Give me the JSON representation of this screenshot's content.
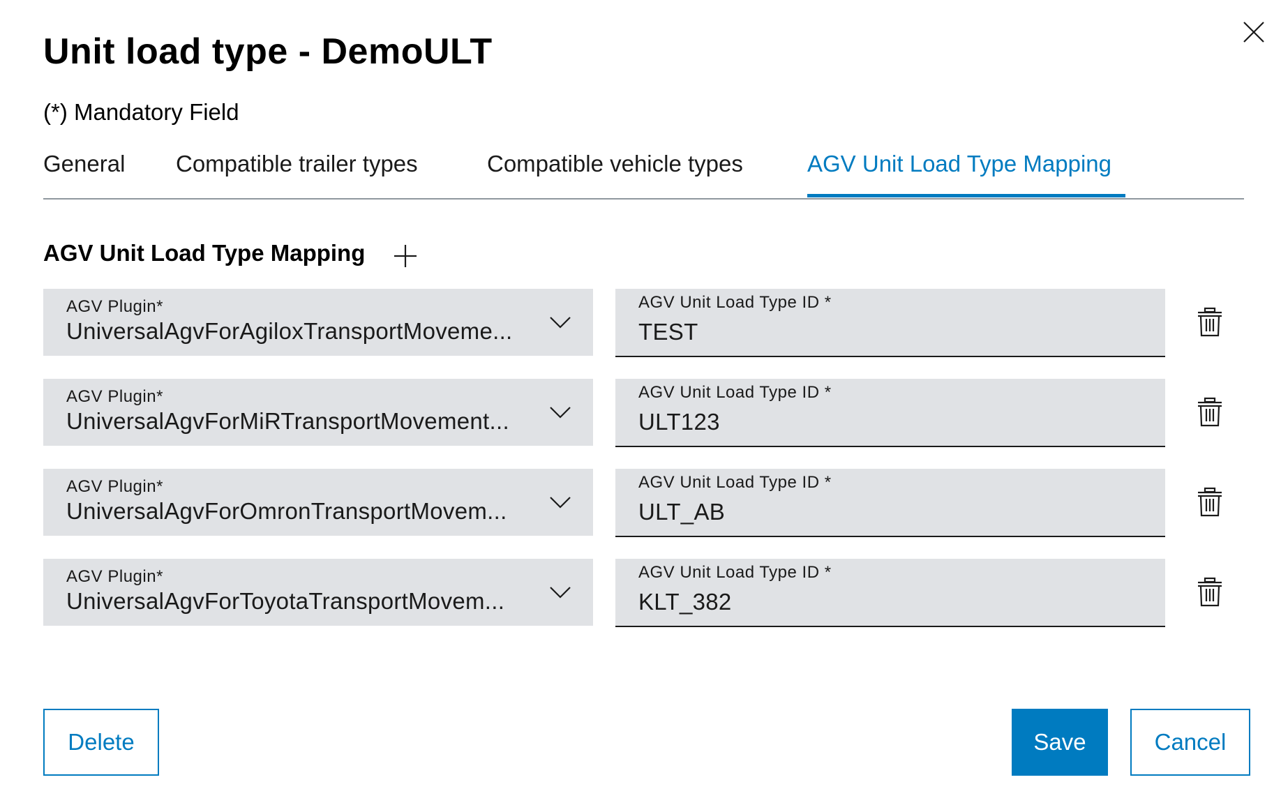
{
  "dialog": {
    "title": "Unit load type - DemoULT",
    "mandatory_note": "(*) Mandatory Field",
    "close_icon": "close-icon"
  },
  "tabs": [
    {
      "label": "General",
      "active": false
    },
    {
      "label": "Compatible trailer types",
      "active": false
    },
    {
      "label": "Compatible vehicle types",
      "active": false
    },
    {
      "label": "AGV Unit Load Type Mapping",
      "active": true
    }
  ],
  "section": {
    "title": "AGV Unit Load Type Mapping",
    "add_icon": "plus-icon"
  },
  "mappings": [
    {
      "plugin_label": "AGV Plugin*",
      "plugin_value": "UniversalAgvForAgiloxTransportMoveme...",
      "id_label": "AGV Unit Load Type ID *",
      "id_value": "TEST"
    },
    {
      "plugin_label": "AGV Plugin*",
      "plugin_value": "UniversalAgvForMiRTransportMovement...",
      "id_label": "AGV Unit Load Type ID *",
      "id_value": "ULT123"
    },
    {
      "plugin_label": "AGV Plugin*",
      "plugin_value": "UniversalAgvForOmronTransportMovem...",
      "id_label": "AGV Unit Load Type ID *",
      "id_value": "ULT_AB"
    },
    {
      "plugin_label": "AGV Plugin*",
      "plugin_value": "UniversalAgvForToyotaTransportMovem...",
      "id_label": "AGV Unit Load Type ID *",
      "id_value": "KLT_382"
    }
  ],
  "actions": {
    "delete_label": "Delete",
    "save_label": "Save",
    "cancel_label": "Cancel"
  },
  "colors": {
    "accent": "#007bc0",
    "field_bg": "#e0e2e5",
    "text": "#1a1a1a"
  }
}
